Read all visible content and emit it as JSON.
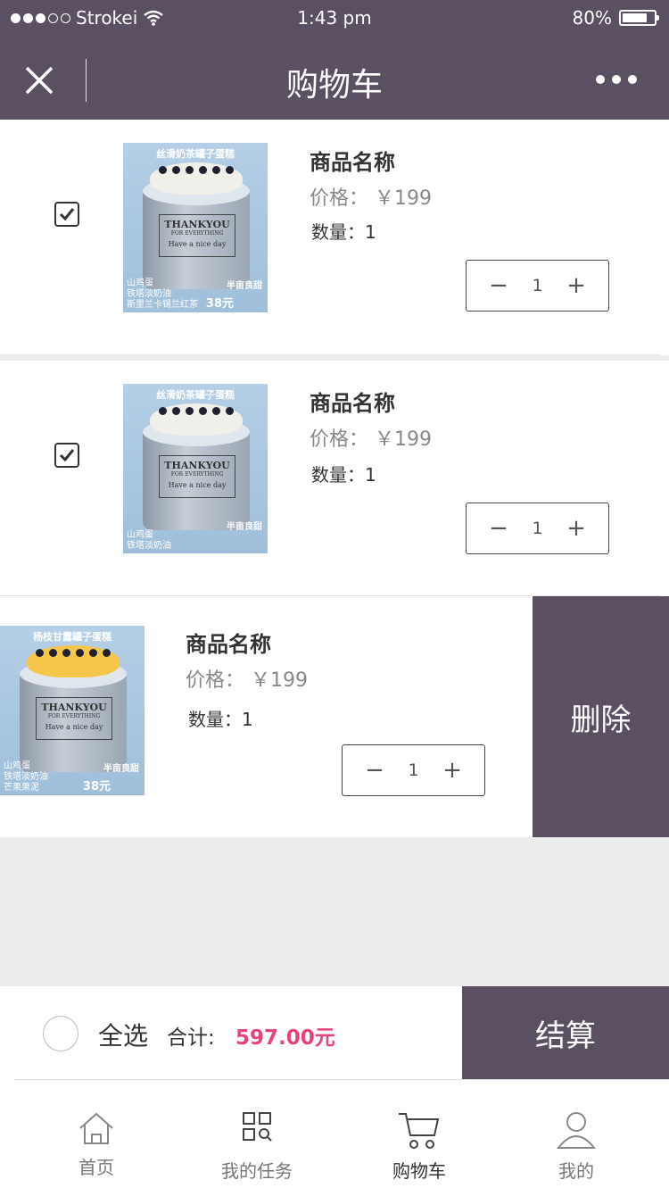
{
  "status_bar": {
    "carrier": "Strokei",
    "time": "1:43 pm",
    "battery": "80%",
    "battery_level": 0.8
  },
  "navbar": {
    "title": "购物车",
    "close_icon": "close-icon",
    "more_icon": "more-icon"
  },
  "items": [
    {
      "name": "商品名称",
      "price_label": "价格：",
      "price": "￥199",
      "qty_label": "数量：1",
      "qty": "1",
      "checked": true,
      "image_banner": "丝滑奶茶罐子蛋糕",
      "image_notes": "山鸡蛋\n铁塔淡奶油\n斯里兰卡锡兰红茶",
      "image_price": "38元",
      "image_brand": "半亩良甜"
    },
    {
      "name": "商品名称",
      "price_label": "价格：",
      "price": "￥199",
      "qty_label": "数量：1",
      "qty": "1",
      "checked": true,
      "image_banner": "丝滑奶茶罐子蛋糕",
      "image_notes": "山鸡蛋\n铁塔淡奶油",
      "image_brand": "半亩良甜"
    },
    {
      "name": "商品名称",
      "price_label": "价格：",
      "price": "￥199",
      "qty_label": "数量：1",
      "qty": "1",
      "checked": false,
      "image_banner": "杨枝甘露罐子蛋糕",
      "image_notes": "山鸡蛋\n铁塔淡奶油\n芒果果泥",
      "image_price": "38元",
      "image_brand": "半亩良甜",
      "delete_label": "删除"
    }
  ],
  "image_label": {
    "big": "THANKYOU",
    "small": "FOR EVERYTHING",
    "nice": "Have a nice day"
  },
  "checkout": {
    "select_all": "全选",
    "total_label": "合计:",
    "total_value": "597.00元",
    "settle_label": "结算"
  },
  "tabbar": [
    {
      "label": "首页",
      "icon": "home-icon",
      "active": false
    },
    {
      "label": "我的任务",
      "icon": "task-grid-icon",
      "active": false
    },
    {
      "label": "购物车",
      "icon": "cart-icon",
      "active": true
    },
    {
      "label": "我的",
      "icon": "user-icon",
      "active": false
    }
  ],
  "colors": {
    "primary": "#5a5061",
    "accent": "#e8427b",
    "background": "#ececec"
  }
}
